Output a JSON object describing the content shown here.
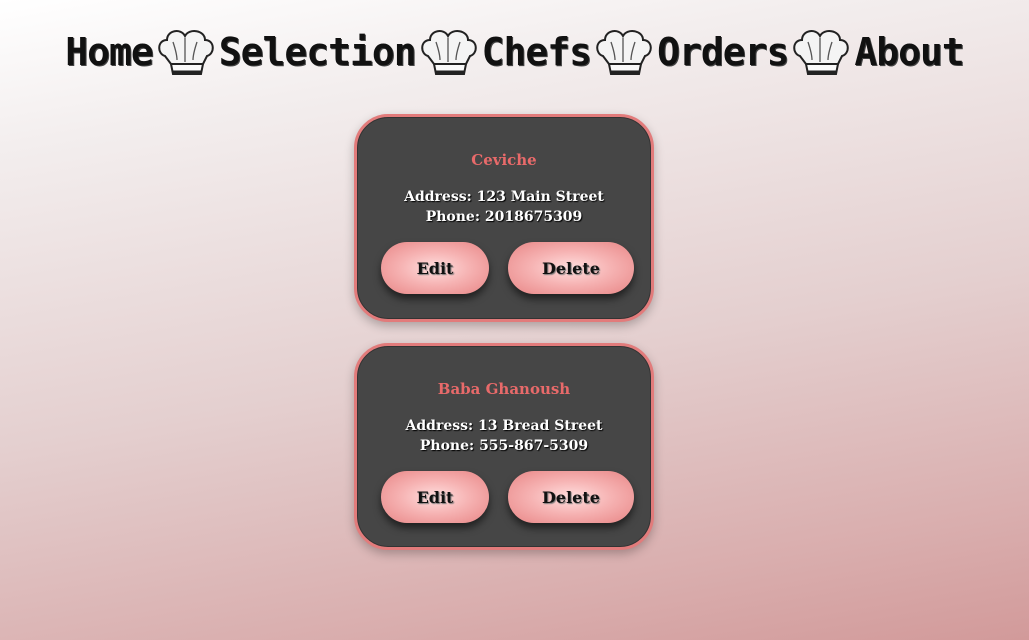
{
  "nav": {
    "items": [
      {
        "label": "Home"
      },
      {
        "label": "Selection"
      },
      {
        "label": "Chefs"
      },
      {
        "label": "Orders"
      },
      {
        "label": "About"
      }
    ],
    "separator_icon": "chef-hat-icon"
  },
  "restaurants": [
    {
      "name": "Ceviche",
      "address": "Address: 123 Main Street",
      "phone": "Phone: 2018675309",
      "edit_label": "Edit",
      "delete_label": "Delete"
    },
    {
      "name": "Baba Ghanoush",
      "address": "Address: 13 Bread Street",
      "phone": "Phone: 555-867-5309",
      "edit_label": "Edit",
      "delete_label": "Delete"
    }
  ],
  "colors": {
    "accent": "#e27b7b",
    "card_bg": "#464646",
    "title_color": "#e86a6a"
  }
}
